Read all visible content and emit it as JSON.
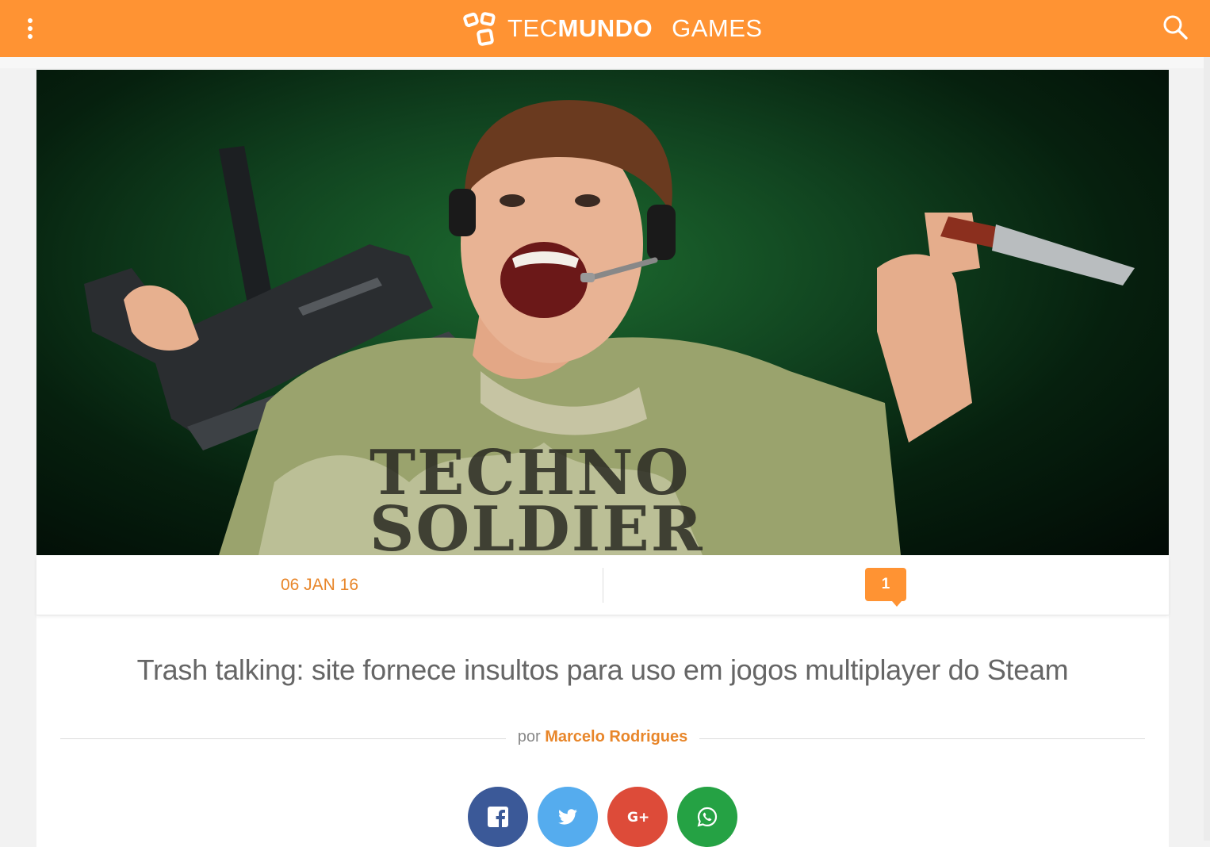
{
  "header": {
    "brand_light": "TEC",
    "brand_bold": "MUNDO",
    "section": "GAMES",
    "menu_icon": "kebab-menu-icon",
    "search_icon": "search-icon",
    "color": "#ff9333"
  },
  "hero": {
    "shirt_line1": "TECHNO",
    "shirt_line2": "SOLDIER"
  },
  "meta": {
    "date": "06 JAN 16",
    "comment_count": "1"
  },
  "article": {
    "title": "Trash talking: site fornece insultos para uso em jogos multiplayer do Steam",
    "by_prefix": "por",
    "author": "Marcelo Rodrigues"
  },
  "share": [
    {
      "network": "facebook",
      "icon": "facebook-icon",
      "color": "#3b5998"
    },
    {
      "network": "twitter",
      "icon": "twitter-icon",
      "color": "#55acee"
    },
    {
      "network": "google-plus",
      "icon": "google-plus-icon",
      "color": "#dd4b39",
      "label": "G+"
    },
    {
      "network": "whatsapp",
      "icon": "whatsapp-icon",
      "color": "#25a244"
    }
  ],
  "colors": {
    "accent": "#ff9333",
    "accent_text": "#e8862a"
  }
}
